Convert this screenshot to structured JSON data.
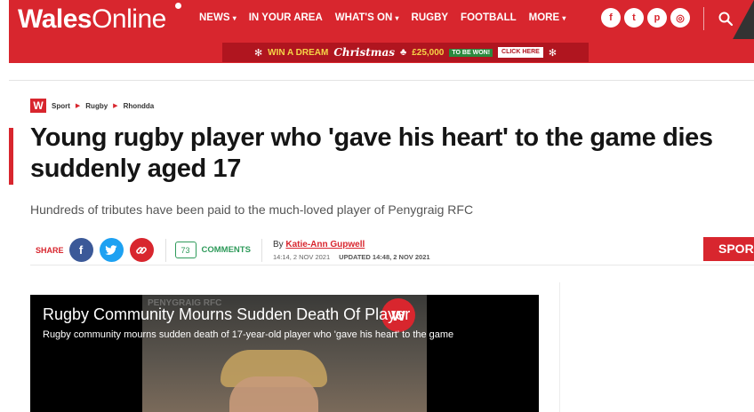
{
  "header": {
    "logo_part1": "Wales",
    "logo_part2": "Online",
    "nav": [
      {
        "label": "NEWS",
        "caret": "▾"
      },
      {
        "label": "IN YOUR AREA",
        "caret": ""
      },
      {
        "label": "WHAT'S ON",
        "caret": "▾"
      },
      {
        "label": "RUGBY",
        "caret": ""
      },
      {
        "label": "FOOTBALL",
        "caret": ""
      },
      {
        "label": "MORE",
        "caret": "▾"
      }
    ],
    "social_icons": [
      "f",
      "t",
      "p",
      "◎"
    ],
    "accent_color": "#d8262e"
  },
  "banner": {
    "win": "WIN A DREAM",
    "christmas": "Christmas",
    "amount": "£25,000",
    "tag": "TO BE WON!",
    "cta": "CLICK HERE"
  },
  "breadcrumb": {
    "badge": "W",
    "items": [
      "Sport",
      "Rugby",
      "Rhondda"
    ],
    "separator": "▶"
  },
  "article": {
    "headline": "Young rugby player who 'gave his heart' to the game dies suddenly aged 17",
    "standfirst": "Hundreds of tributes have been paid to the much-loved player of Penygraig RFC",
    "share_label": "SHARE",
    "comment_count": "73",
    "comments_label": "COMMENTS",
    "by": "By",
    "author": "Katie-Ann Gupwell",
    "published": "14:14, 2 NOV 2021",
    "updated": "UPDATED 14:48, 2 NOV 2021",
    "side_tab": "SPOR"
  },
  "video": {
    "watermark": "PENYGRAIG RFC",
    "logo": "w",
    "title": "Rugby Community Mourns Sudden Death Of Player",
    "subtitle": "Rugby community mourns sudden death of 17-year-old player who 'gave his heart' to the game"
  }
}
